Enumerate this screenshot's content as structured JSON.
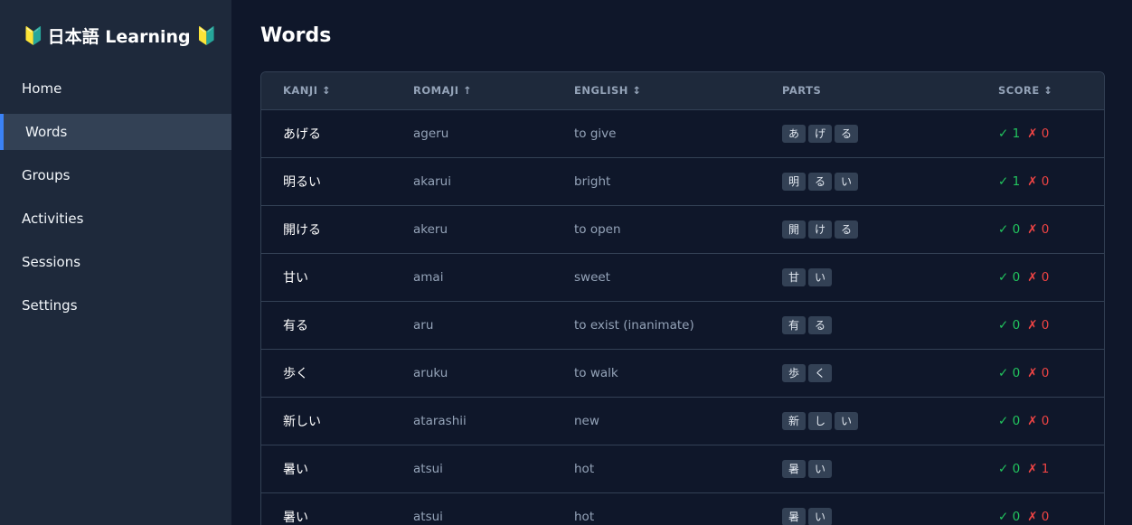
{
  "brand": {
    "icon_left": "🔰",
    "title": "日本語 Learning",
    "icon_right": "🔰"
  },
  "sidebar": {
    "items": [
      {
        "label": "Home"
      },
      {
        "label": "Words"
      },
      {
        "label": "Groups"
      },
      {
        "label": "Activities"
      },
      {
        "label": "Sessions"
      },
      {
        "label": "Settings"
      }
    ],
    "active_index": 1
  },
  "page": {
    "title": "Words"
  },
  "table": {
    "headers": {
      "kanji": "KANJI ↕",
      "romaji": "ROMAJI ↑",
      "english": "ENGLISH ↕",
      "parts": "PARTS",
      "score": "SCORE ↕"
    },
    "rows": [
      {
        "kanji": "あげる",
        "romaji": "ageru",
        "english": "to give",
        "parts": [
          "あ",
          "げ",
          "る"
        ],
        "correct": "✓ 1",
        "wrong": "✗ 0"
      },
      {
        "kanji": "明るい",
        "romaji": "akarui",
        "english": "bright",
        "parts": [
          "明",
          "る",
          "い"
        ],
        "correct": "✓ 1",
        "wrong": "✗ 0"
      },
      {
        "kanji": "開ける",
        "romaji": "akeru",
        "english": "to open",
        "parts": [
          "開",
          "け",
          "る"
        ],
        "correct": "✓ 0",
        "wrong": "✗ 0"
      },
      {
        "kanji": "甘い",
        "romaji": "amai",
        "english": "sweet",
        "parts": [
          "甘",
          "い"
        ],
        "correct": "✓ 0",
        "wrong": "✗ 0"
      },
      {
        "kanji": "有る",
        "romaji": "aru",
        "english": "to exist (inanimate)",
        "parts": [
          "有",
          "る"
        ],
        "correct": "✓ 0",
        "wrong": "✗ 0"
      },
      {
        "kanji": "歩く",
        "romaji": "aruku",
        "english": "to walk",
        "parts": [
          "歩",
          "く"
        ],
        "correct": "✓ 0",
        "wrong": "✗ 0"
      },
      {
        "kanji": "新しい",
        "romaji": "atarashii",
        "english": "new",
        "parts": [
          "新",
          "し",
          "い"
        ],
        "correct": "✓ 0",
        "wrong": "✗ 0"
      },
      {
        "kanji": "暑い",
        "romaji": "atsui",
        "english": "hot",
        "parts": [
          "暑",
          "い"
        ],
        "correct": "✓ 0",
        "wrong": "✗ 1"
      },
      {
        "kanji": "暑い",
        "romaji": "atsui",
        "english": "hot",
        "parts": [
          "暑",
          "い"
        ],
        "correct": "✓ 0",
        "wrong": "✗ 0"
      }
    ]
  },
  "colors": {
    "accent": "#3b82f6",
    "correct": "#22c55e",
    "wrong": "#ef4444"
  }
}
